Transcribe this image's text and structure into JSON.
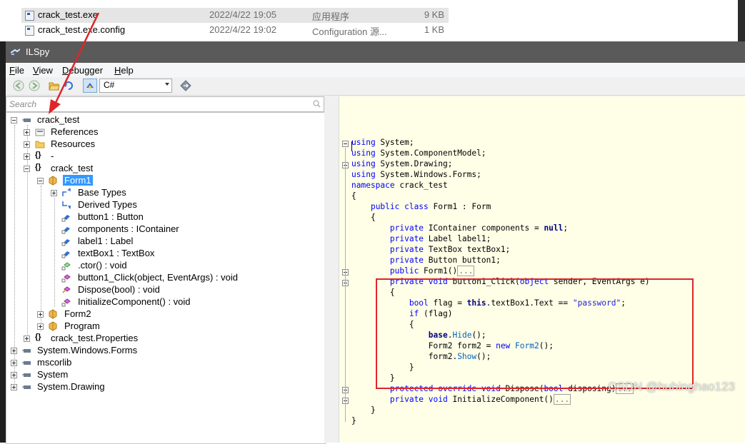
{
  "explorer": {
    "files": [
      {
        "name": "crack_test.exe",
        "date": "2022/4/22 19:05",
        "type": "应用程序",
        "size": "9 KB",
        "selected": true
      },
      {
        "name": "crack_test.exe.config",
        "date": "2022/4/22 19:02",
        "type": "Configuration 源...",
        "size": "1 KB",
        "selected": false
      }
    ]
  },
  "window": {
    "title": "ILSpy"
  },
  "menu": {
    "items": [
      {
        "label": "File",
        "access_key": "F",
        "rest": "ile"
      },
      {
        "label": "View",
        "access_key": "V",
        "rest": "iew"
      },
      {
        "label": "Debugger",
        "access_key": "D",
        "rest": "ebugger"
      },
      {
        "label": "Help",
        "access_key": "H",
        "rest": "elp"
      }
    ]
  },
  "toolbar": {
    "language": "C#",
    "icons": [
      "back-icon",
      "forward-icon",
      "open-icon",
      "reload-icon",
      "show-private-icon",
      "navigate-icon"
    ]
  },
  "search": {
    "placeholder": "Search"
  },
  "tree": {
    "nodes": [
      {
        "label": "crack_test",
        "icon": "assembly-icon"
      },
      {
        "label": "References",
        "icon": "references-icon"
      },
      {
        "label": "Resources",
        "icon": "folder-icon"
      },
      {
        "label": "-",
        "icon": "namespace-icon"
      },
      {
        "label": "crack_test",
        "icon": "namespace-icon"
      },
      {
        "label": "Form1",
        "icon": "class-icon"
      },
      {
        "label": "Base Types",
        "icon": "base-types-icon"
      },
      {
        "label": "Derived Types",
        "icon": "derived-types-icon"
      },
      {
        "label": "button1 : Button",
        "icon": "field-icon"
      },
      {
        "label": "components : IContainer",
        "icon": "field-icon"
      },
      {
        "label": "label1 : Label",
        "icon": "field-icon"
      },
      {
        "label": "textBox1 : TextBox",
        "icon": "field-icon"
      },
      {
        "label": ".ctor() : void",
        "icon": "method-icon"
      },
      {
        "label": "button1_Click(object, EventArgs) : void",
        "icon": "method-icon"
      },
      {
        "label": "Dispose(bool) : void",
        "icon": "method-icon"
      },
      {
        "label": "InitializeComponent() : void",
        "icon": "method-icon"
      },
      {
        "label": "Form2",
        "icon": "class-icon"
      },
      {
        "label": "Program",
        "icon": "class-icon"
      },
      {
        "label": "crack_test.Properties",
        "icon": "namespace-icon"
      },
      {
        "label": "System.Windows.Forms",
        "icon": "assembly-icon"
      },
      {
        "label": "mscorlib",
        "icon": "assembly-icon"
      },
      {
        "label": "System",
        "icon": "assembly-icon"
      },
      {
        "label": "System.Drawing",
        "icon": "assembly-icon"
      }
    ]
  },
  "code": {
    "lines": [
      [
        [
          "kw",
          "using"
        ],
        [
          "t",
          " System;"
        ]
      ],
      [
        [
          "kw",
          "using"
        ],
        [
          "t",
          " System.ComponentModel;"
        ]
      ],
      [
        [
          "kw",
          "using"
        ],
        [
          "t",
          " System.Drawing;"
        ]
      ],
      [
        [
          "kw",
          "using"
        ],
        [
          "t",
          " System.Windows.Forms;"
        ]
      ],
      [
        [
          "kw",
          "namespace"
        ],
        [
          "t",
          " crack_test"
        ]
      ],
      [
        [
          "t",
          "{"
        ]
      ],
      [
        [
          "t",
          "    "
        ],
        [
          "kw",
          "public class"
        ],
        [
          "t",
          " Form1 : Form"
        ]
      ],
      [
        [
          "t",
          "    {"
        ]
      ],
      [
        [
          "t",
          "        "
        ],
        [
          "kw",
          "private"
        ],
        [
          "t",
          " IContainer components = "
        ],
        [
          "kb",
          "null"
        ],
        [
          "t",
          ";"
        ]
      ],
      [
        [
          "t",
          "        "
        ],
        [
          "kw",
          "private"
        ],
        [
          "t",
          " Label label1;"
        ]
      ],
      [
        [
          "t",
          "        "
        ],
        [
          "kw",
          "private"
        ],
        [
          "t",
          " TextBox textBox1;"
        ]
      ],
      [
        [
          "t",
          "        "
        ],
        [
          "kw",
          "private"
        ],
        [
          "t",
          " Button button1;"
        ]
      ],
      [
        [
          "t",
          "        "
        ],
        [
          "kw",
          "public"
        ],
        [
          "t",
          " Form1()"
        ],
        [
          "e",
          "..."
        ]
      ],
      [
        [
          "t",
          "        "
        ],
        [
          "kw",
          "private void"
        ],
        [
          "t",
          " button1_Click("
        ],
        [
          "kw",
          "object"
        ],
        [
          "t",
          " sender, EventArgs e)"
        ]
      ],
      [
        [
          "t",
          "        {"
        ]
      ],
      [
        [
          "t",
          "            "
        ],
        [
          "kw",
          "bool"
        ],
        [
          "t",
          " flag = "
        ],
        [
          "kb",
          "this"
        ],
        [
          "t",
          ".textBox1.Text == "
        ],
        [
          "str",
          "\"password\""
        ],
        [
          "t",
          ";"
        ]
      ],
      [
        [
          "t",
          "            "
        ],
        [
          "kw",
          "if"
        ],
        [
          "t",
          " (flag)"
        ]
      ],
      [
        [
          "t",
          "            {"
        ]
      ],
      [
        [
          "t",
          "                "
        ],
        [
          "kb",
          "base"
        ],
        [
          "t",
          "."
        ],
        [
          "fn",
          "Hide"
        ],
        [
          "t",
          "();"
        ]
      ],
      [
        [
          "t",
          "                Form2 form2 = "
        ],
        [
          "kw",
          "new"
        ],
        [
          "t",
          " "
        ],
        [
          "fn",
          "Form2"
        ],
        [
          "t",
          "();"
        ]
      ],
      [
        [
          "t",
          "                form2."
        ],
        [
          "fn",
          "Show"
        ],
        [
          "t",
          "();"
        ]
      ],
      [
        [
          "t",
          "            }"
        ]
      ],
      [
        [
          "t",
          "        }"
        ]
      ],
      [
        [
          "t",
          "        "
        ],
        [
          "kw",
          "protected override void"
        ],
        [
          "t",
          " Dispose("
        ],
        [
          "kw",
          "bool"
        ],
        [
          "t",
          " disposing)"
        ],
        [
          "e",
          "..."
        ]
      ],
      [
        [
          "t",
          "        "
        ],
        [
          "kw",
          "private void"
        ],
        [
          "t",
          " InitializeComponent()"
        ],
        [
          "e",
          "..."
        ]
      ],
      [
        [
          "t",
          "    }"
        ]
      ],
      [
        [
          "t",
          "}"
        ]
      ]
    ]
  },
  "watermark": "CSDN @huhinghao123",
  "colors": {
    "selection": "#3399ff",
    "highlight_box": "#e0242a",
    "code_bg": "#ffffe7",
    "keyword": "#0000ff",
    "arrow": "#e0242a"
  }
}
